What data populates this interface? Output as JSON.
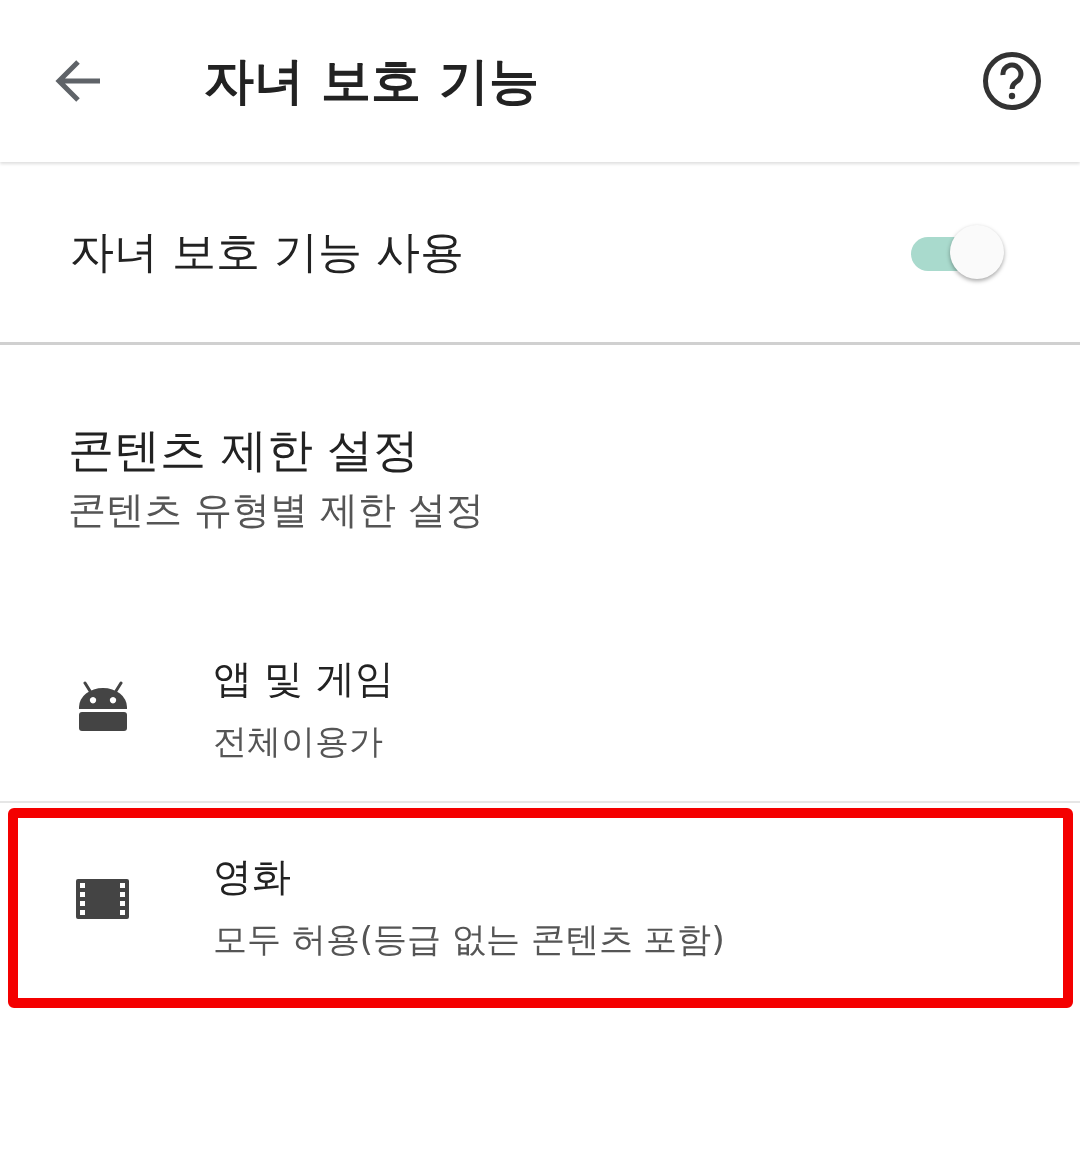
{
  "app_bar": {
    "title": "자녀 보호 기능"
  },
  "master_switch": {
    "label": "자녀 보호 기능 사용",
    "on": true
  },
  "section": {
    "title": "콘텐츠 제한 설정",
    "subtitle": "콘텐츠 유형별 제한 설정"
  },
  "items": [
    {
      "kind": "android",
      "title": "앱 및 게임",
      "subtitle": "전체이용가",
      "highlighted": false
    },
    {
      "kind": "film",
      "title": "영화",
      "subtitle": "모두 허용(등급 없는 콘텐츠 포함)",
      "highlighted": true
    }
  ]
}
